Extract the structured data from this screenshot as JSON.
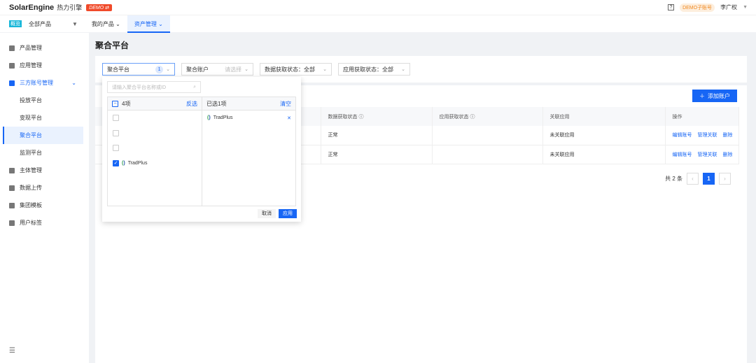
{
  "header": {
    "logo": "SolarEngine",
    "logo_cn": "热力引擎",
    "demo": "DEMO ⇄",
    "sub_account": "DEMO子账号",
    "user": "李广权"
  },
  "nav": {
    "badge": "概览",
    "product": "全部产品",
    "items": [
      "我的产品",
      "资产管理"
    ]
  },
  "sidebar": {
    "items": [
      "产品管理",
      "应用管理",
      "三方账号管理",
      "投放平台",
      "变现平台",
      "聚合平台",
      "监测平台",
      "主体管理",
      "数据上传",
      "集团模板",
      "用户标签"
    ]
  },
  "page": {
    "title": "聚合平台"
  },
  "filters": {
    "platform": {
      "label": "聚合平台",
      "count": "1"
    },
    "account": {
      "label": "聚合账户",
      "placeholder": "请选择"
    },
    "data_status": "数据获取状态：全部",
    "app_status": "应用获取状态：全部"
  },
  "dropdown": {
    "search_placeholder": "请输入聚合平台名称或ID",
    "left_title": "4项",
    "invert": "反选",
    "right_title": "已选1项",
    "clear": "清空",
    "item": "TradPlus",
    "cancel": "取消",
    "apply": "应用"
  },
  "table": {
    "add_button": "添加账户",
    "headers": [
      "数据获取状态",
      "应用获取状态",
      "关联应用",
      "操作"
    ],
    "rows": [
      {
        "data_status": "正常",
        "app_status": "",
        "linked": "未关联应用"
      },
      {
        "data_status": "正常",
        "app_status": "",
        "linked": "未关联应用"
      }
    ],
    "actions": [
      "编辑账号",
      "管理关联",
      "删除"
    ]
  },
  "pagination": {
    "total": "共 2 条",
    "page": "1"
  }
}
